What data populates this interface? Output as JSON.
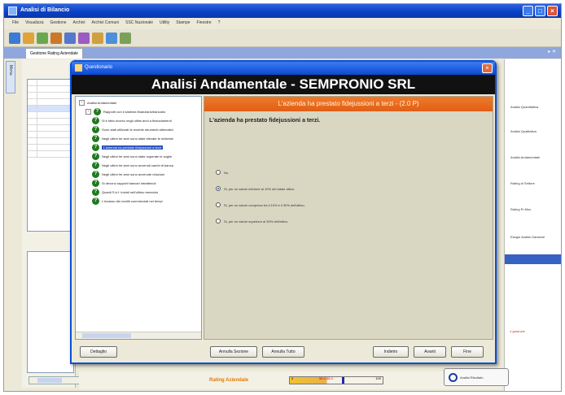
{
  "window": {
    "title": "Analisi di Bilancio",
    "menu": [
      "File",
      "Visualizza",
      "Gestione",
      "Archivi",
      "Archivi Comuni",
      "SSC Nazionale",
      "Utility",
      "Stampe",
      "Finestre",
      "?"
    ],
    "toolbar_colors": [
      "#3b7bd4",
      "#e2a23a",
      "#6aa84f",
      "#c9782c",
      "#5577cc",
      "#9a5bc3",
      "#d0a040",
      "#4d8fd8",
      "#7aa05a"
    ]
  },
  "tabs": {
    "active": "Gestione Rating Aziendale",
    "vertical": "Menu"
  },
  "right_panel": {
    "items": [
      "Analisi Quantitativa",
      "Analisi Qualitativa",
      "Analisi Andamentale",
      "Rating di Settore",
      "Rating Pr.Mov.",
      "Esegui Analisi Garanzie"
    ],
    "note": "4 garanzie"
  },
  "bottom": {
    "rating_label": "Rating Aziendale",
    "scale_min": "0",
    "scale_mid": "56.4  65.0",
    "scale_max": "100",
    "rating_value_pct": 0.56,
    "analyze_button": "Analisi Risultato"
  },
  "dialog": {
    "title": "Questionario",
    "header": "Analisi Andamentale - SEMPRONIO SRL",
    "tree": {
      "root": "Analisi Andamentale",
      "group": "Rapporti con il sistema finanziario/bancario",
      "items": [
        "Si è fatto ricorso negli ultimi anni a finanziamenti",
        "Sono stati utilizzati di recente strumenti alternativi",
        "Negli ultimi tre anni sono state elevate le richieste",
        "L'azienda ha prestato fidejussioni a terzi",
        "Negli ultimi tre anni sono state superate le soglie",
        "Negli ultimi tre anni sono avvenuti cambi di banca",
        "Negli ultimi tre anni sono avvenute riduzioni",
        "Si devono rapporti bancari intrattenuti",
        "Quanti S.b.f. inviati nell'ultimo esercizio",
        "L'incasso dei crediti commerciali nei tempi"
      ],
      "selected_index": 3
    },
    "question": {
      "title": "L'azienda ha prestato fidejussioni a terzi - (2.0 P)",
      "text": "L'azienda ha prestato fidejussioni a terzi.",
      "options": [
        "No.",
        "Si, per un valore inferiore al 10% del totale attivo.",
        "Si, per un valore compreso tra il 10% e il 30% dell'attivo.",
        "Si, per un valore superiore al 30% dell'attivo."
      ],
      "selected_option": 1
    },
    "buttons": {
      "help": "Dettaglio",
      "cancel_section": "Annulla Sezione",
      "cancel_all": "Annulla Tutto",
      "back": "Indietro",
      "next": "Avanti",
      "end": "Fine"
    }
  }
}
